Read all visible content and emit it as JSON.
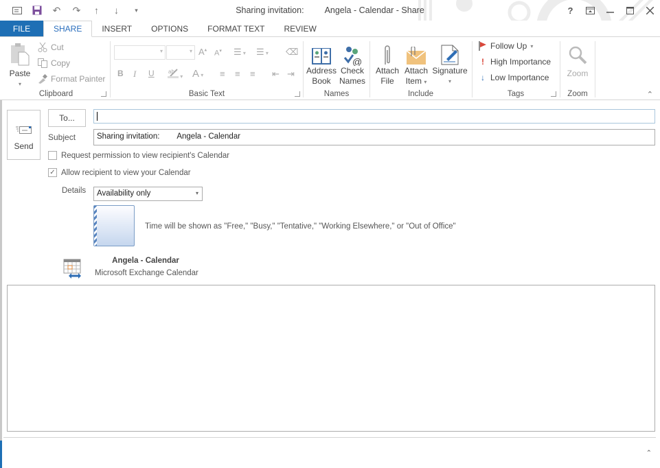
{
  "window": {
    "title_prefix": "Sharing invitation:",
    "title_suffix": "Angela - Calendar - Share",
    "controls": {
      "help": "?",
      "ribbon_display": "ribbon-display-options-icon",
      "minimize": "minimize-icon",
      "maximize": "maximize-icon",
      "close": "close-icon"
    }
  },
  "quick_access": [
    "message-icon",
    "save-icon",
    "undo-icon",
    "redo-icon",
    "previous-item-icon",
    "next-item-icon",
    "customize-qat-icon"
  ],
  "tabs": [
    {
      "label": "FILE"
    },
    {
      "label": "SHARE",
      "active": true
    },
    {
      "label": "INSERT"
    },
    {
      "label": "OPTIONS"
    },
    {
      "label": "FORMAT TEXT"
    },
    {
      "label": "REVIEW"
    }
  ],
  "ribbon": {
    "clipboard": {
      "label": "Clipboard",
      "paste": "Paste",
      "cut": "Cut",
      "copy": "Copy",
      "format_painter": "Format Painter"
    },
    "basic_text": {
      "label": "Basic Text",
      "font_name": "",
      "font_size": "",
      "bold": "B",
      "italic": "I",
      "underline": "U",
      "font_color": "A",
      "grow": "A",
      "shrink": "A"
    },
    "names": {
      "label": "Names",
      "address_book_1": "Address",
      "address_book_2": "Book",
      "check_names_1": "Check",
      "check_names_2": "Names"
    },
    "include": {
      "label": "Include",
      "attach_file_1": "Attach",
      "attach_file_2": "File",
      "attach_item_1": "Attach",
      "attach_item_2": "Item",
      "signature": "Signature"
    },
    "tags": {
      "label": "Tags",
      "follow_up": "Follow Up",
      "high_importance": "High Importance",
      "low_importance": "Low Importance"
    },
    "zoom": {
      "label": "Zoom",
      "zoom_button": "Zoom"
    }
  },
  "compose": {
    "send": "Send",
    "to_button": "To...",
    "to_value": "",
    "subject_label": "Subject",
    "subject_value": "Sharing invitation:        Angela - Calendar",
    "request_permission": {
      "label": "Request permission to view recipient's Calendar",
      "checked": false
    },
    "allow_view": {
      "label": "Allow recipient to view your Calendar",
      "checked": true
    },
    "details_label": "Details",
    "details_value": "Availability only",
    "preview_text": "Time will be shown as \"Free,\" \"Busy,\" \"Tentative,\" \"Working Elsewhere,\" or \"Out of Office\"",
    "calendar_name": "        Angela - Calendar",
    "calendar_type": "Microsoft Exchange Calendar",
    "body": ""
  },
  "colors": {
    "accent": "#1e6fb5",
    "active_tab_text": "#2a6ebd",
    "flag_red": "#d9483b",
    "low_importance_blue": "#2f6eb5"
  }
}
